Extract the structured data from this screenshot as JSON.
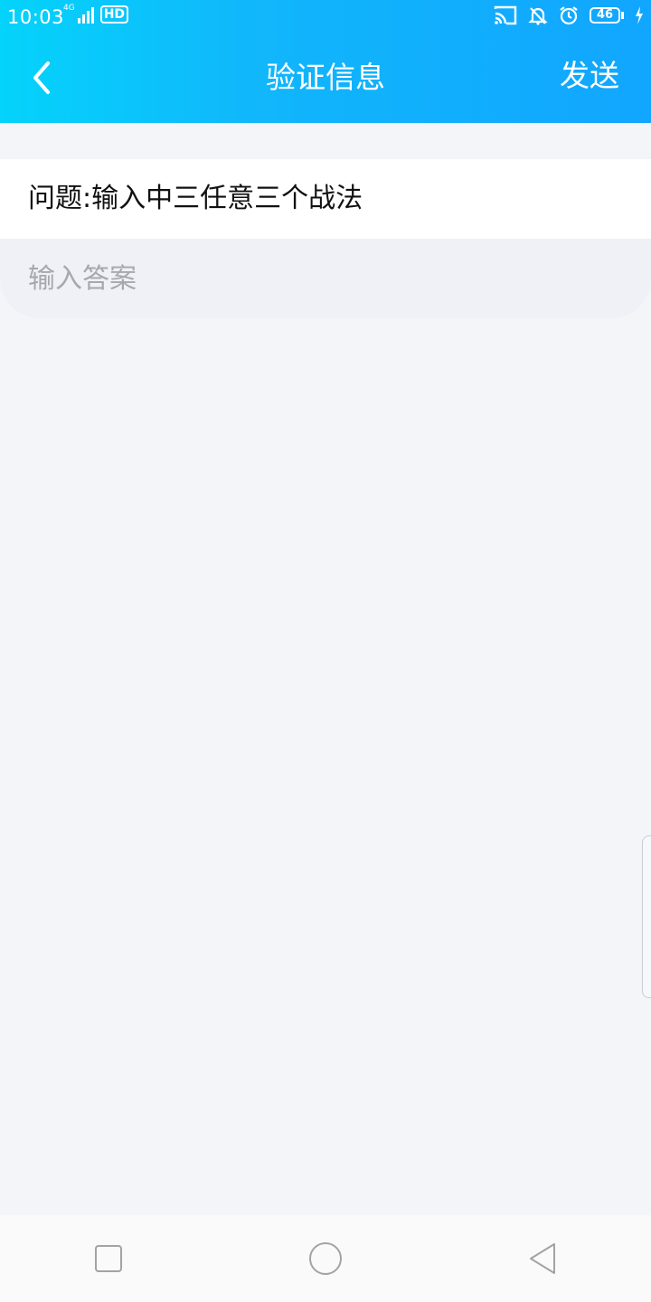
{
  "status_bar": {
    "time": "10:03",
    "network": "4G",
    "hd": "HD",
    "battery": "46"
  },
  "header": {
    "title": "验证信息",
    "send_label": "发送"
  },
  "question": {
    "text": "问题:输入中三任意三个战法"
  },
  "answer": {
    "placeholder": "输入答案",
    "value": ""
  },
  "colors": {
    "header_gradient_start": "#04d3fb",
    "header_gradient_end": "#11a6ff",
    "page_background": "#f3f5f9"
  },
  "icons": {
    "back": "chevron-left-icon",
    "nav_recent": "square-icon",
    "nav_home": "circle-icon",
    "nav_back": "triangle-left-icon"
  }
}
